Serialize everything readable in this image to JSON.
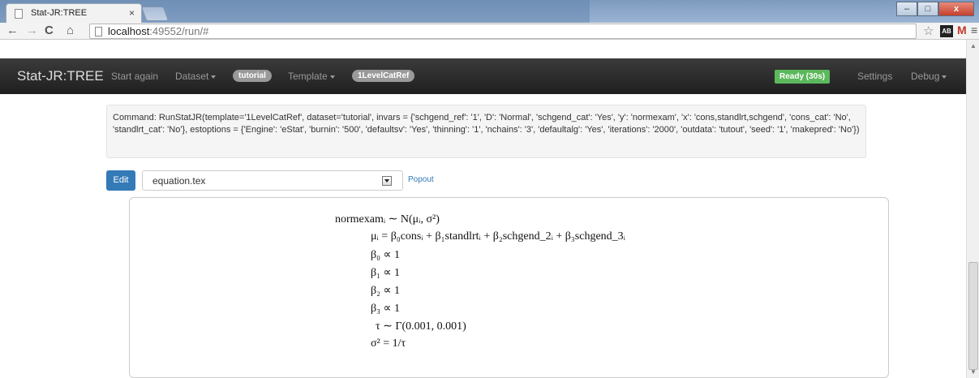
{
  "browser": {
    "tab_title": "Stat-JR:TREE",
    "tab_close": "×",
    "url_host": "localhost",
    "url_path": ":49552/run/#",
    "window_buttons": [
      "–",
      "□",
      "x"
    ]
  },
  "navbar": {
    "brand": "Stat-JR:TREE",
    "start_again": "Start again",
    "dataset": "Dataset",
    "dataset_value": "tutorial",
    "template": "Template",
    "template_value": "1LevelCatRef",
    "status": "Ready (30s)",
    "settings": "Settings",
    "debug": "Debug"
  },
  "command": {
    "text": "Command: RunStatJR(template='1LevelCatRef', dataset='tutorial', invars = {'schgend_ref': '1', 'D': 'Normal', 'schgend_cat': 'Yes', 'y': 'normexam', 'x': 'cons,standlrt,schgend', 'cons_cat': 'No', 'standlrt_cat': 'No'}, estoptions = {'Engine': 'eStat', 'burnin': '500', 'defaultsv': 'Yes', 'thinning': '1', 'nchains': '3', 'defaultalg': 'Yes', 'iterations': '2000', 'outdata': 'tutout', 'seed': '1', 'makepred': 'No'})"
  },
  "editor": {
    "edit_label": "Edit",
    "selected_file": "equation.tex",
    "popout_label": "Popout"
  },
  "equations": {
    "lines": [
      "normexamᵢ ∼ N(μᵢ, σ²)",
      "μᵢ = β₀consᵢ + β₁standlrtᵢ + β₂schgend_2ᵢ + β₃schgend_3ᵢ",
      "β₀ ∝ 1",
      "β₁ ∝ 1",
      "β₂ ∝ 1",
      "β₃ ∝ 1",
      "τ ∼ Γ(0.001, 0.001)",
      "σ² = 1/τ"
    ]
  },
  "colors": {
    "navbar_bg": "#222222",
    "primary": "#337ab7",
    "success": "#5cb85c",
    "pill": "#999999"
  }
}
